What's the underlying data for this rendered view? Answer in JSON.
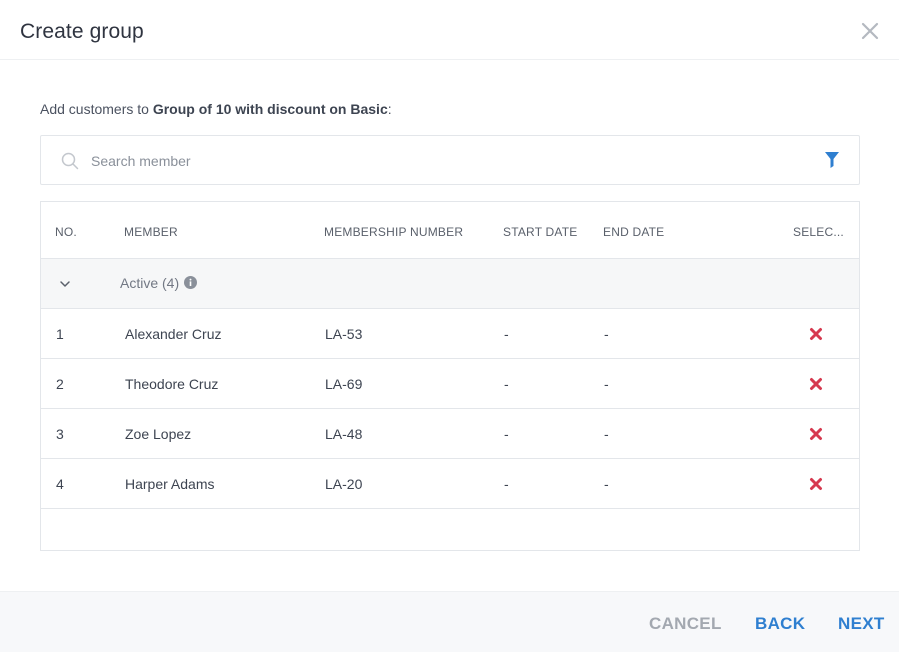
{
  "dialog": {
    "title": "Create group",
    "intro_prefix": "Add customers to ",
    "group_name": "Group of 10 with discount on Basic",
    "intro_suffix": ":"
  },
  "search": {
    "placeholder": "Search member",
    "icon": "search-icon",
    "filter_icon": "filter-icon"
  },
  "table": {
    "headers": [
      "NO.",
      "MEMBER",
      "MEMBERSHIP NUMBER",
      "START DATE",
      "END DATE",
      "SELEC..."
    ],
    "group": {
      "label": "Active (4)",
      "expanded": true
    },
    "rows": [
      {
        "no": "1",
        "member": "Alexander Cruz",
        "membership": "LA-53",
        "start": "-",
        "end": "-"
      },
      {
        "no": "2",
        "member": "Theodore Cruz",
        "membership": "LA-69",
        "start": "-",
        "end": "-"
      },
      {
        "no": "3",
        "member": "Zoe Lopez",
        "membership": "LA-48",
        "start": "-",
        "end": "-"
      },
      {
        "no": "4",
        "member": "Harper Adams",
        "membership": "LA-20",
        "start": "-",
        "end": "-"
      }
    ]
  },
  "footer": {
    "cancel_label": "CANCEL",
    "back_label": "BACK",
    "next_label": "NEXT"
  },
  "colors": {
    "accent": "#2f7fd0",
    "remove": "#d6394f",
    "muted": "#a3a8b0"
  }
}
